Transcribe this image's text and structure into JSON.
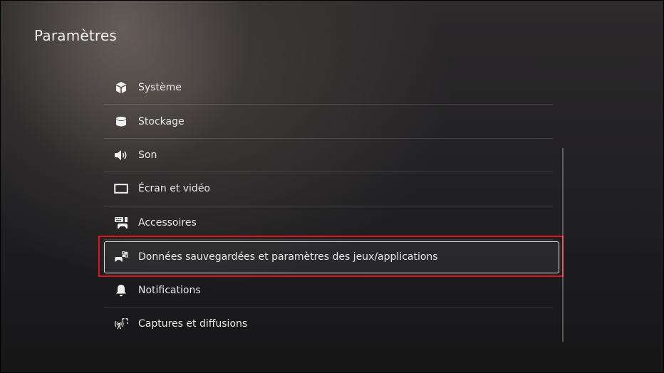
{
  "page": {
    "title": "Paramètres"
  },
  "menu": {
    "items": [
      {
        "label": "Système",
        "icon": "cube-icon"
      },
      {
        "label": "Stockage",
        "icon": "storage-icon"
      },
      {
        "label": "Son",
        "icon": "speaker-icon"
      },
      {
        "label": "Écran et vidéo",
        "icon": "display-icon"
      },
      {
        "label": "Accessoires",
        "icon": "accessories-icon"
      },
      {
        "label": "Données sauvegardées et paramètres des jeux/applications",
        "icon": "saved-data-icon",
        "selected": true
      },
      {
        "label": "Notifications",
        "icon": "bell-icon"
      },
      {
        "label": "Captures et diffusions",
        "icon": "capture-broadcast-icon"
      }
    ]
  },
  "colors": {
    "highlight": "#e0141b",
    "text": "#e9e9e9"
  }
}
